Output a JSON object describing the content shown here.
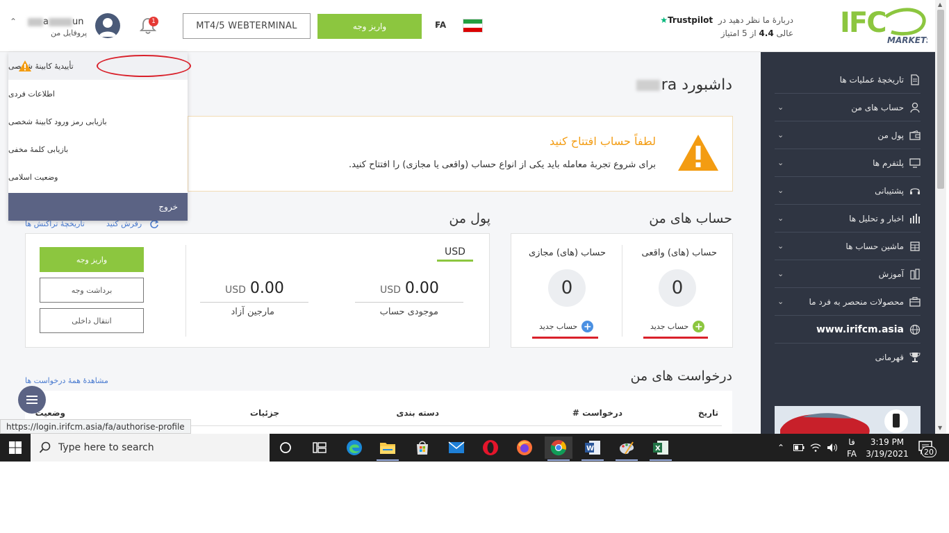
{
  "header": {
    "brand": "IFC",
    "brand_sub": "MARKETS",
    "trustpilot_prefix": "دربارهٔ ما نظر دهید در",
    "trustpilot_brand": "Trustpilot",
    "rating_text": "عالی",
    "rating_value": "4.4",
    "rating_suffix": "از 5 امتیاز",
    "language": "FA",
    "deposit_button": "واریز وجه",
    "webterminal_button": "MT4/5 WEBTERMINAL",
    "notification_count": "1",
    "username_start": "",
    "username_a": "a",
    "username_end": "un",
    "profile_label": "پروفایل من"
  },
  "dropdown": {
    "items": [
      {
        "label": "تأییدیهٔ کابینهٔ شخصی"
      },
      {
        "label": "اطلاعات فردی"
      },
      {
        "label": "بازیابی رمز ورود کابینهٔ شخصی"
      },
      {
        "label": "بازیابی کلمهٔ مخفی"
      },
      {
        "label": "وضعیت اسلامی"
      }
    ],
    "logout": "خروج"
  },
  "sidebar": {
    "items": [
      {
        "label": "تاریخچهٔ عملیات ها",
        "icon": "document-icon"
      },
      {
        "label": "حساب های من",
        "icon": "user-icon"
      },
      {
        "label": "پول من",
        "icon": "wallet-icon"
      },
      {
        "label": "پلتفرم ها",
        "icon": "monitor-icon"
      },
      {
        "label": "پشتیبانی",
        "icon": "headset-icon"
      },
      {
        "label": "اخبار و تحلیل ها",
        "icon": "chart-bars-icon"
      },
      {
        "label": "ماشین حساب ها",
        "icon": "calculator-icon"
      },
      {
        "label": "آموزش",
        "icon": "education-icon"
      },
      {
        "label": "محصولات منحصر به فرد ما",
        "icon": "briefcase-icon"
      }
    ],
    "website": "www.irifcm.asia",
    "champion": "قهرمانی"
  },
  "main": {
    "dashboard_title": "داشبورد",
    "dashboard_name_visible": "ra",
    "alert_title": "لطفاً حساب افتتاح کنید",
    "alert_text": "برای شروع تجربهٔ معامله باید یکی از انواع حساب (واقعی یا مجازی) را افتتاح کنید.",
    "my_accounts_title": "حساب های من",
    "real_accounts_label": "حساب (های) واقعی",
    "real_accounts_count": "0",
    "demo_accounts_label": "حساب (های) مجازی",
    "demo_accounts_count": "0",
    "new_account_label": "حساب جدید",
    "my_money_title": "پول من",
    "refresh_link": "رفرش کنید",
    "transactions_link": "تاریخچهٔ تراکنش ها",
    "currency_tab": "USD",
    "balance_value": "0.00",
    "balance_currency": "USD",
    "balance_label": "موجودی حساب",
    "free_margin_value": "0.00",
    "free_margin_currency": "USD",
    "free_margin_label": "مارجین آزاد",
    "deposit_button": "واریز وجه",
    "withdraw_button": "برداشت وجه",
    "transfer_button": "انتقال داخلی",
    "requests_title": "درخواست های من",
    "view_all_requests": "مشاهدهٔ همهٔ درخواست ها",
    "table_headers": [
      "تاریخ",
      "درخواست #",
      "دسته بندی",
      "جزئیات",
      "وضعیت"
    ]
  },
  "status_url": "https://login.irifcm.asia/fa/authorise-profile",
  "taskbar": {
    "search_placeholder": "Type here to search",
    "lang_top": "فا",
    "lang_bottom": "FA",
    "time": "3:19 PM",
    "date": "3/19/2021",
    "notification_count": "20"
  },
  "colors": {
    "accent_green": "#8cc63f",
    "warning_orange": "#f39c12",
    "sidebar_bg": "#2f3542",
    "highlight_red": "#d9202a",
    "link_blue": "#4a7bd0"
  }
}
